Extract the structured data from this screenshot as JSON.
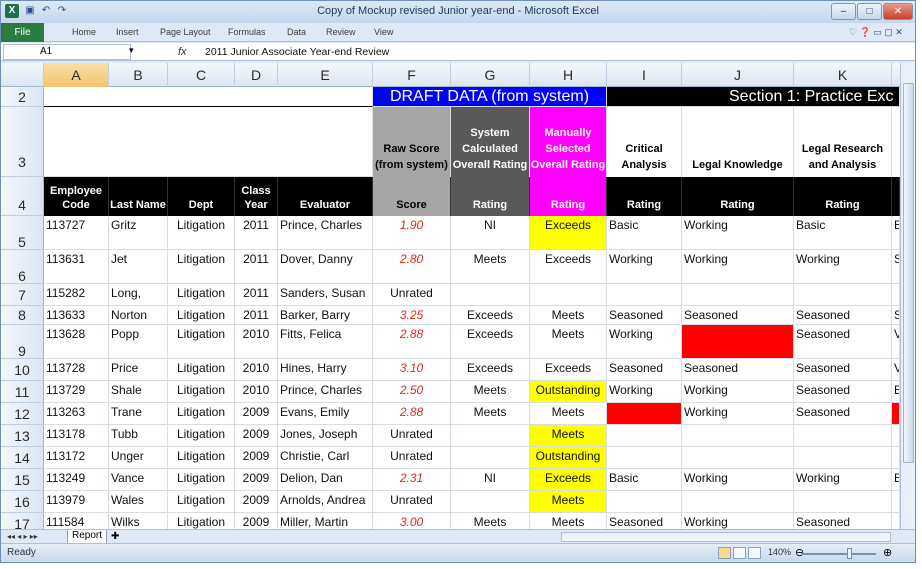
{
  "window": {
    "title": "Copy of Mockup revised Junior year-end - Microsoft Excel"
  },
  "ribbon": {
    "file": "File",
    "tabs": [
      "Home",
      "Insert",
      "Page Layout",
      "Formulas",
      "Data",
      "Review",
      "View"
    ]
  },
  "formula_bar": {
    "name_box": "A1",
    "fx": "fx",
    "value": "2011 Junior Associate Year-end Review"
  },
  "columns": [
    "A",
    "B",
    "C",
    "D",
    "E",
    "F",
    "G",
    "H",
    "I",
    "J",
    "K"
  ],
  "rows": {
    "r2": "2",
    "r3": "3",
    "r4": "4",
    "banner_draft": "DRAFT DATA (from system)",
    "banner_section": "Section 1: Practice Exc",
    "h3": {
      "raw_score": "Raw Score (from system)",
      "sys_rating": "System Calculated Overall Rating",
      "man_rating": "Manually Selected Overall Rating",
      "critical": "Critical Analysis",
      "legal_knowledge": "Legal Knowledge",
      "legal_research": "Legal Research and Analysis"
    },
    "h4": {
      "emp_code": "Employee Code",
      "last_name": "Last Name",
      "dept": "Dept",
      "class_year": "Class Year",
      "evaluator": "Evaluator",
      "score": "Score",
      "rating_g": "Rating",
      "rating_h": "Rating",
      "rating_i": "Rating",
      "rating_j": "Rating",
      "rating_k": "Rating"
    }
  },
  "data_rows": [
    {
      "row": "5",
      "code": "113727",
      "name": "Gritz",
      "dept": "Litigation",
      "year": "2011",
      "evaluator": "Prince, Charles",
      "score": "1.90",
      "sys": "NI",
      "man": "Exceeds",
      "crit": "Basic",
      "know": "Working",
      "research": "Basic",
      "extra": "B"
    },
    {
      "row": "6",
      "code": "113631",
      "name": "Jet",
      "dept": "Litigation",
      "year": "2011",
      "evaluator": "Dover, Danny",
      "score": "2.80",
      "sys": "Meets",
      "man": "Exceeds",
      "crit": "Working",
      "know": "Working",
      "research": "Working",
      "extra": "S"
    },
    {
      "row": "7",
      "code": "115282",
      "name": "Long,",
      "dept": "Litigation",
      "year": "2011",
      "evaluator": "Sanders, Susan",
      "score": "Unrated",
      "sys": "",
      "man": "",
      "crit": "",
      "know": "",
      "research": "",
      "extra": ""
    },
    {
      "row": "8",
      "code": "113633",
      "name": "Norton",
      "dept": "Litigation",
      "year": "2011",
      "evaluator": "Barker, Barry",
      "score": "3.25",
      "sys": "Exceeds",
      "man": "Meets",
      "crit": "Seasoned",
      "know": "Seasoned",
      "research": "Seasoned",
      "extra": "S"
    },
    {
      "row": "9",
      "code": "113628",
      "name": "Popp",
      "dept": "Litigation",
      "year": "2010",
      "evaluator": "Fitts, Felica",
      "score": "2.88",
      "sys": "Exceeds",
      "man": "Meets",
      "crit": "Working",
      "know": "",
      "research": "Seasoned",
      "extra": "V"
    },
    {
      "row": "10",
      "code": "113728",
      "name": "Price",
      "dept": "Litigation",
      "year": "2010",
      "evaluator": "Hines, Harry",
      "score": "3.10",
      "sys": "Exceeds",
      "man": "Exceeds",
      "crit": "Seasoned",
      "know": "Seasoned",
      "research": "Seasoned",
      "extra": "V"
    },
    {
      "row": "11",
      "code": "113729",
      "name": "Shale",
      "dept": "Litigation",
      "year": "2010",
      "evaluator": "Prince, Charles",
      "score": "2.50",
      "sys": "Meets",
      "man": "Outstanding",
      "crit": "Working",
      "know": "Working",
      "research": "Seasoned",
      "extra": "B"
    },
    {
      "row": "12",
      "code": "113263",
      "name": "Trane",
      "dept": "Litigation",
      "year": "2009",
      "evaluator": "Evans, Emily",
      "score": "2.88",
      "sys": "Meets",
      "man": "Meets",
      "crit": "",
      "know": "Working",
      "research": "Seasoned",
      "extra": ""
    },
    {
      "row": "13",
      "code": "113178",
      "name": "Tubb",
      "dept": "Litigation",
      "year": "2009",
      "evaluator": "Jones, Joseph",
      "score": "Unrated",
      "sys": "",
      "man": "Meets",
      "crit": "",
      "know": "",
      "research": "",
      "extra": ""
    },
    {
      "row": "14",
      "code": "113172",
      "name": "Unger",
      "dept": "Litigation",
      "year": "2009",
      "evaluator": "Christie, Carl",
      "score": "Unrated",
      "sys": "",
      "man": "Outstanding",
      "crit": "",
      "know": "",
      "research": "",
      "extra": ""
    },
    {
      "row": "15",
      "code": "113249",
      "name": "Vance",
      "dept": "Litigation",
      "year": "2009",
      "evaluator": "Delion, Dan",
      "score": "2.31",
      "sys": "NI",
      "man": "Exceeds",
      "crit": "Basic",
      "know": "Working",
      "research": "Working",
      "extra": "B"
    },
    {
      "row": "16",
      "code": "113979",
      "name": "Wales",
      "dept": "Litigation",
      "year": "2009",
      "evaluator": "Arnolds, Andrea",
      "score": "Unrated",
      "sys": "",
      "man": "Meets",
      "crit": "",
      "know": "",
      "research": "",
      "extra": ""
    },
    {
      "row": "17",
      "code": "111584",
      "name": "Wilks",
      "dept": "Litigation",
      "year": "2009",
      "evaluator": "Miller, Martin",
      "score": "3.00",
      "sys": "Meets",
      "man": "Meets",
      "crit": "Seasoned",
      "know": "Working",
      "research": "Seasoned",
      "extra": ""
    }
  ],
  "sheet": {
    "tab": "Report"
  },
  "status": {
    "ready": "Ready",
    "zoom": "140%"
  },
  "colors": {
    "draft_banner": "#0000ff",
    "raw_score_header": "#a6a6a6",
    "sys_rating_header": "#595959",
    "manual_header": "#ff00ff",
    "highlight_yellow": "#ffff00",
    "fill_red": "#ff0000",
    "score_text": "#e0271b"
  }
}
